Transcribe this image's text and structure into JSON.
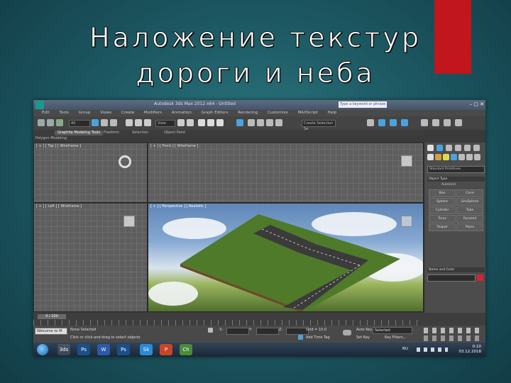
{
  "slide": {
    "title_line1": "Наложение текстур",
    "title_line2": "дороги и неба",
    "accent_color": "#c0161c"
  },
  "window": {
    "title": "Autodesk 3ds Max 2012 x64 - Untitled",
    "search_placeholder": "Type a keyword or phrase",
    "controls": "– ▢ ✕"
  },
  "menu": [
    "Edit",
    "Tools",
    "Group",
    "Views",
    "Create",
    "Modifiers",
    "Animation",
    "Graph Editors",
    "Rendering",
    "Customize",
    "MAXScript",
    "Help"
  ],
  "toolbar": {
    "selection_filter": "All",
    "view_dropdown": "View",
    "selection_set": "Create Selection Se"
  },
  "ribbon": {
    "tabs": [
      "Graphite Modeling Tools",
      "Freeform",
      "Selection",
      "Object Paint"
    ],
    "active_tab": 0,
    "sub_label": "Polygon Modeling"
  },
  "viewports": {
    "top": "[ + ] [ Top ] [ Wireframe ]",
    "front": "[ + ] [ Front ] [ Wireframe ]",
    "left": "[ + ] [ Left ] [ Wireframe ]",
    "perspective": "[ + ] [ Perspective ] [ Realistic ]"
  },
  "command_panel": {
    "category": "Standard Primitives",
    "object_type_header": "Object Type",
    "autogrid": "AutoGrid",
    "primitives": [
      "Box",
      "Cone",
      "Sphere",
      "GeoSphere",
      "Cylinder",
      "Tube",
      "Torus",
      "Pyramid",
      "Teapot",
      "Plane"
    ],
    "name_color_header": "Name and Color"
  },
  "timeline": {
    "frame": "0 / 100"
  },
  "status": {
    "selection": "None Selected",
    "prompt": "Click or click-and-drag to select objects",
    "welcome": "Welcome to M",
    "x_label": "X:",
    "y_label": "Y:",
    "z_label": "Z:",
    "grid": "Grid = 10,0",
    "add_time_tag": "Add Time Tag",
    "auto_key": "Auto Key",
    "set_key": "Set Key",
    "key_mode": "Selected",
    "key_filters": "Key Filters..."
  },
  "taskbar": {
    "apps": [
      "3ds",
      "Ps",
      "W",
      "Ps",
      "Sk",
      "P",
      "Ch"
    ],
    "lang": "RU",
    "time": "0:10",
    "date": "03.12.2018"
  }
}
